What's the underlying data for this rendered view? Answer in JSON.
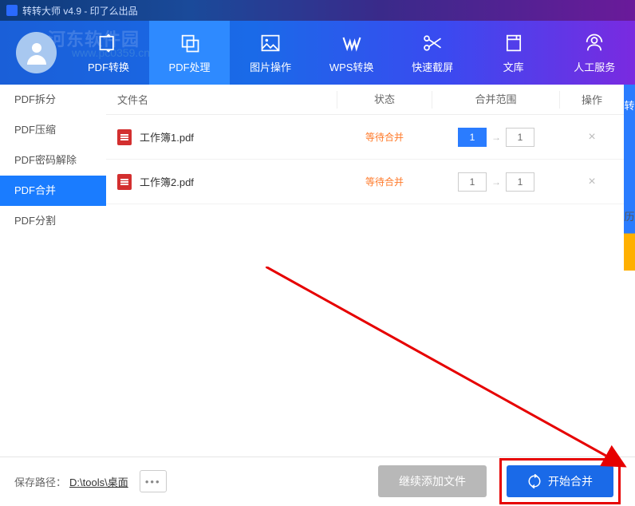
{
  "app_title": "转转大师 v4.9 - 印了么出品",
  "watermark1": "河东软件园",
  "watermark2": "www.pc0359.cn",
  "nav": [
    {
      "label": "PDF转换"
    },
    {
      "label": "PDF处理"
    },
    {
      "label": "图片操作"
    },
    {
      "label": "WPS转换"
    },
    {
      "label": "快速截屏"
    },
    {
      "label": "文库"
    },
    {
      "label": "人工服务"
    }
  ],
  "sidebar": [
    {
      "label": "PDF拆分"
    },
    {
      "label": "PDF压缩"
    },
    {
      "label": "PDF密码解除"
    },
    {
      "label": "PDF合并"
    },
    {
      "label": "PDF分割"
    }
  ],
  "columns": {
    "name": "文件名",
    "status": "状态",
    "range": "合并范围",
    "op": "操作"
  },
  "files": [
    {
      "name": "工作簿1.pdf",
      "status": "等待合并",
      "from": "1",
      "to": "1"
    },
    {
      "name": "工作簿2.pdf",
      "status": "等待合并",
      "from": "1",
      "to": "1"
    }
  ],
  "rightstrip": {
    "a": "转",
    "b": "历"
  },
  "footer": {
    "save_label": "保存路径：",
    "save_path": "D:\\tools\\桌面",
    "more": "•••",
    "add_more": "继续添加文件",
    "start": "开始合并"
  }
}
